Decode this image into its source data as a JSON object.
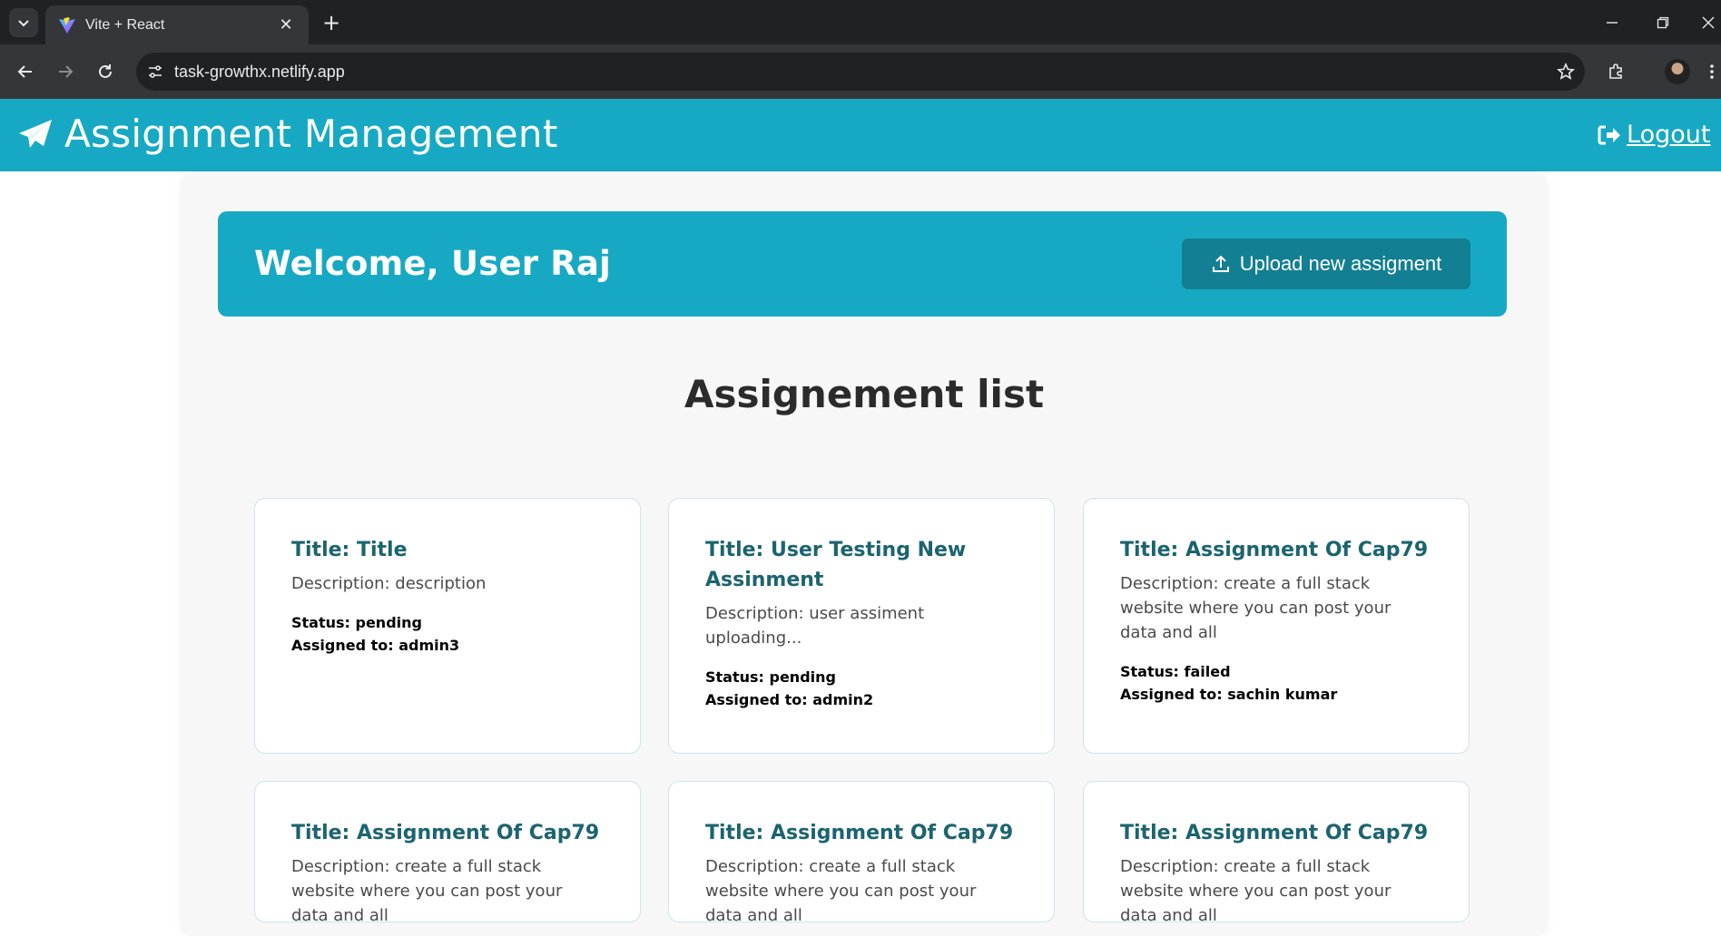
{
  "browser": {
    "tab_title": "Vite + React",
    "url": "task-growthx.netlify.app",
    "icons": {
      "tab_search": "chevron-down-icon",
      "close_tab": "close-icon",
      "new_tab": "plus-icon",
      "back": "arrow-left-icon",
      "forward": "arrow-right-icon",
      "reload": "reload-icon",
      "site_info": "tune-icon",
      "bookmark": "star-icon",
      "extensions": "puzzle-icon",
      "menu": "kebab-menu-icon"
    }
  },
  "header": {
    "title": "Assignment Management",
    "logout_label": "Logout",
    "accent_color": "#17a9c3"
  },
  "welcome": {
    "text": "Welcome, User Raj",
    "upload_label": "Upload new assigment",
    "button_color": "#137f92"
  },
  "list": {
    "title": "Assignement list",
    "cards": [
      {
        "title": "Title: Title",
        "description": "Description: description",
        "status": "Status: pending",
        "assigned": "Assigned to: admin3"
      },
      {
        "title": "Title: User Testing New Assinment",
        "description": "Description: user assiment uploading...",
        "status": "Status: pending",
        "assigned": "Assigned to: admin2"
      },
      {
        "title": "Title: Assignment Of Cap79",
        "description": "Description: create a full stack website where you can post your data and all",
        "status": "Status: failed",
        "assigned": "Assigned to: sachin kumar"
      },
      {
        "title": "Title: Assignment Of Cap79",
        "description": "Description: create a full stack website where you can post your data and all",
        "status": "",
        "assigned": ""
      },
      {
        "title": "Title: Assignment Of Cap79",
        "description": "Description: create a full stack website where you can post your data and all",
        "status": "",
        "assigned": ""
      },
      {
        "title": "Title: Assignment Of Cap79",
        "description": "Description: create a full stack website where you can post your data and all",
        "status": "",
        "assigned": ""
      }
    ]
  }
}
